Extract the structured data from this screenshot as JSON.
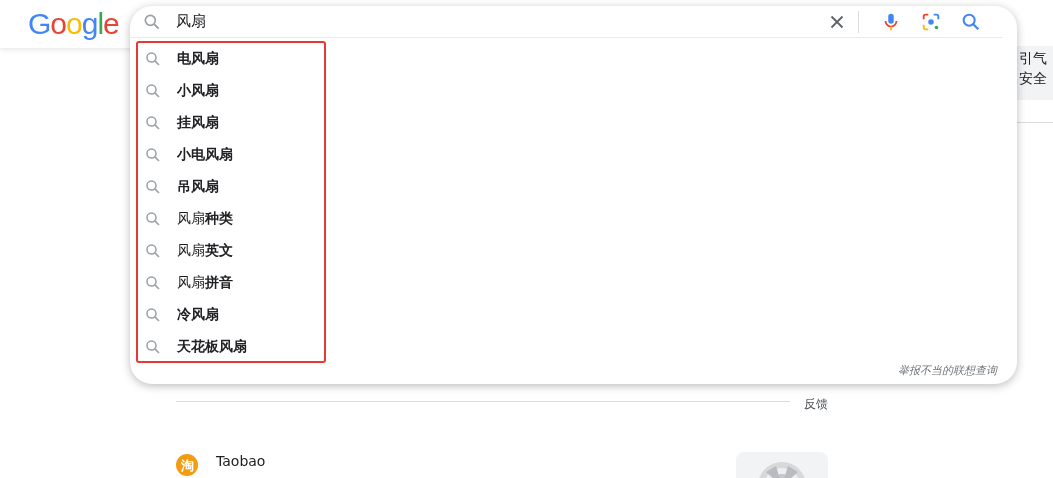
{
  "logo": "Google",
  "search": {
    "value": "风扇"
  },
  "suggestions": [
    {
      "text": "电风扇",
      "kind": "full"
    },
    {
      "text": "小风扇",
      "kind": "full"
    },
    {
      "text": "挂风扇",
      "kind": "full"
    },
    {
      "text": "小电风扇",
      "kind": "full"
    },
    {
      "text": "吊风扇",
      "kind": "full"
    },
    {
      "text": "风扇**种类**",
      "kind": "partial"
    },
    {
      "text": "风扇**英文**",
      "kind": "partial"
    },
    {
      "text": "风扇**拼音**",
      "kind": "partial"
    },
    {
      "text": "冷风扇",
      "kind": "full"
    },
    {
      "text": "天花板风扇",
      "kind": "full"
    }
  ],
  "report_link": "举报不当的联想查询",
  "side_panel": {
    "lines": [
      "引气",
      "安全"
    ]
  },
  "feedback": "反馈",
  "result": {
    "site_icon": "淘",
    "site": "Taobao"
  }
}
